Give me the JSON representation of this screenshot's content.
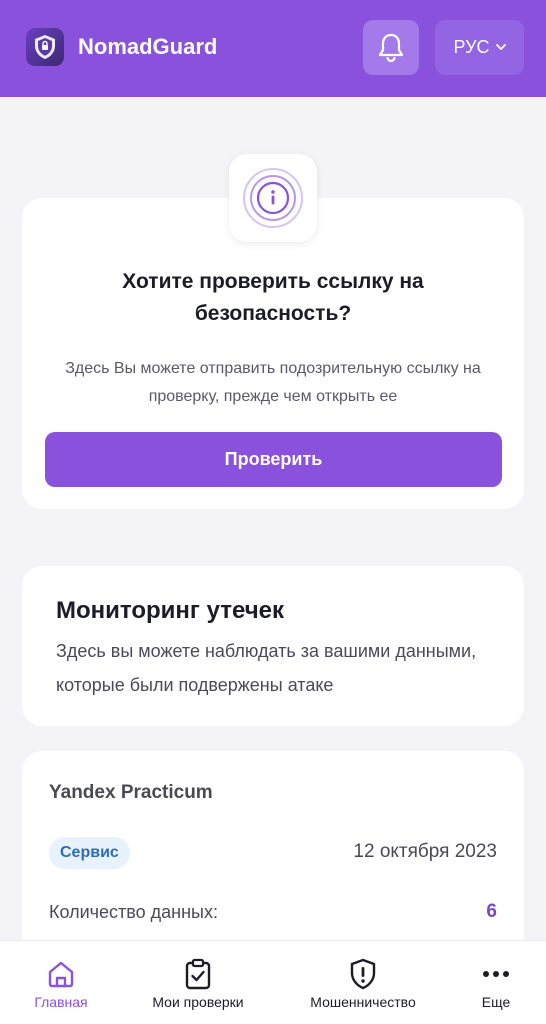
{
  "header": {
    "app_name": "NomadGuard",
    "language": "РУС"
  },
  "check_card": {
    "title": "Хотите проверить ссылку на безопасность?",
    "description": "Здесь Вы можете отправить подозрительную ссылку на проверку, прежде чем открыть ее",
    "button_label": "Проверить"
  },
  "monitor_card": {
    "title": "Мониторинг утечек",
    "description": "Здесь вы можете наблюдать за вашими данными, которые были подвержены атаке"
  },
  "leak_card": {
    "name": "Yandex Practicum",
    "badge": "Сервис",
    "date": "12 октября 2023",
    "count_label": "Количество данных:",
    "count_value": "6"
  },
  "nav": {
    "items": [
      {
        "label": "Главная",
        "icon": "home-icon",
        "active": true
      },
      {
        "label": "Мои проверки",
        "icon": "clipboard-check-icon",
        "active": false
      },
      {
        "label": "Мошенничество",
        "icon": "shield-alert-icon",
        "active": false
      },
      {
        "label": "Еще",
        "icon": "more-icon",
        "active": false
      }
    ]
  },
  "colors": {
    "primary": "#8a52dc",
    "badge_bg": "#e8f2fc",
    "badge_text": "#2e6db4"
  }
}
